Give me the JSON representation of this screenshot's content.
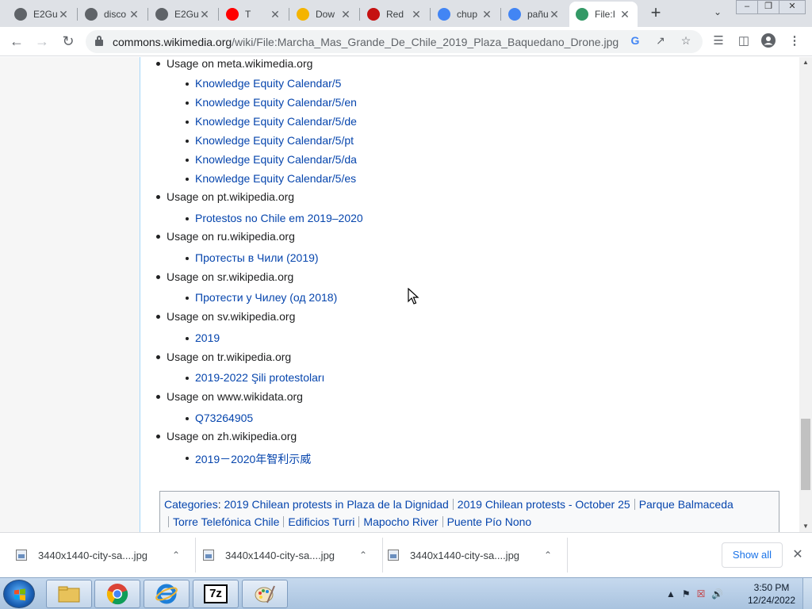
{
  "browser": {
    "tabs": [
      {
        "title": "E2Gu",
        "icon": "globe-icon",
        "color": "#5f6368"
      },
      {
        "title": "disco",
        "icon": "globe-icon",
        "color": "#5f6368"
      },
      {
        "title": "E2Gu",
        "icon": "globe-icon",
        "color": "#5f6368"
      },
      {
        "title": "T",
        "icon": "youtube-icon",
        "color": "#ff0000"
      },
      {
        "title": "Dow",
        "icon": "colorful-icon",
        "color": "#f4b400"
      },
      {
        "title": "Red",
        "icon": "among-us-icon",
        "color": "#c51111"
      },
      {
        "title": "chup",
        "icon": "google-icon",
        "color": "#4285f4"
      },
      {
        "title": "pañu",
        "icon": "google-icon",
        "color": "#4285f4"
      },
      {
        "title": "File:I",
        "icon": "wikimedia-icon",
        "color": "#339966",
        "active": true
      }
    ],
    "url": {
      "host": "commons.wikimedia.org",
      "path": "/wiki/File:Marcha_Mas_Grande_De_Chile_2019_Plaza_Baquedano_Drone.jpg"
    }
  },
  "usages": [
    {
      "site": "Usage on meta.wikimedia.org",
      "links": [
        "Knowledge Equity Calendar/5",
        "Knowledge Equity Calendar/5/en",
        "Knowledge Equity Calendar/5/de",
        "Knowledge Equity Calendar/5/pt",
        "Knowledge Equity Calendar/5/da",
        "Knowledge Equity Calendar/5/es"
      ]
    },
    {
      "site": "Usage on pt.wikipedia.org",
      "links": [
        "Protestos no Chile em 2019–2020"
      ]
    },
    {
      "site": "Usage on ru.wikipedia.org",
      "links": [
        "Протесты в Чили (2019)"
      ]
    },
    {
      "site": "Usage on sr.wikipedia.org",
      "links": [
        "Протести у Чилеу (од 2018)"
      ]
    },
    {
      "site": "Usage on sv.wikipedia.org",
      "links": [
        "2019"
      ]
    },
    {
      "site": "Usage on tr.wikipedia.org",
      "links": [
        "2019-2022 Şili protestoları"
      ]
    },
    {
      "site": "Usage on www.wikidata.org",
      "links": [
        "Q73264905"
      ]
    },
    {
      "site": "Usage on zh.wikipedia.org",
      "links": [
        "2019－2020年智利示威"
      ]
    }
  ],
  "categories": {
    "label": "Categories",
    "items": [
      "2019 Chilean protests in Plaza de la Dignidad",
      "2019 Chilean protests - October 25",
      "Parque Balmaceda",
      "Torre Telefónica Chile",
      "Edificios Turri",
      "Mapocho River",
      "Puente Pío Nono"
    ]
  },
  "downloads": {
    "items": [
      "3440x1440-city-sa....jpg",
      "3440x1440-city-sa....jpg",
      "3440x1440-city-sa....jpg"
    ],
    "show_all": "Show all"
  },
  "taskbar": {
    "apps": [
      "explorer-icon",
      "chrome-icon",
      "internet-explorer-icon",
      "7zip-icon",
      "paint-icon"
    ],
    "sevenzip_label": "7z",
    "time": "3:50 PM",
    "date": "12/24/2022"
  }
}
